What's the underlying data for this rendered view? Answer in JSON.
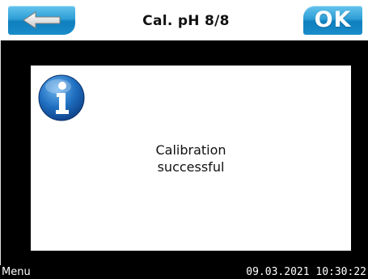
{
  "header": {
    "title": "Cal. pH 8/8",
    "back_icon": "arrow-left-icon",
    "ok_label": "OK"
  },
  "dialog": {
    "icon": "info-icon",
    "message_line1": "Calibration",
    "message_line2": "successful"
  },
  "footer": {
    "menu_label": "Menu",
    "datetime": "09.03.2021 10:30:22"
  },
  "colors": {
    "button_blue": "#2f9fd6",
    "background": "#000000",
    "panel": "#ffffff",
    "info_icon_blue": "#1f6fc0"
  }
}
